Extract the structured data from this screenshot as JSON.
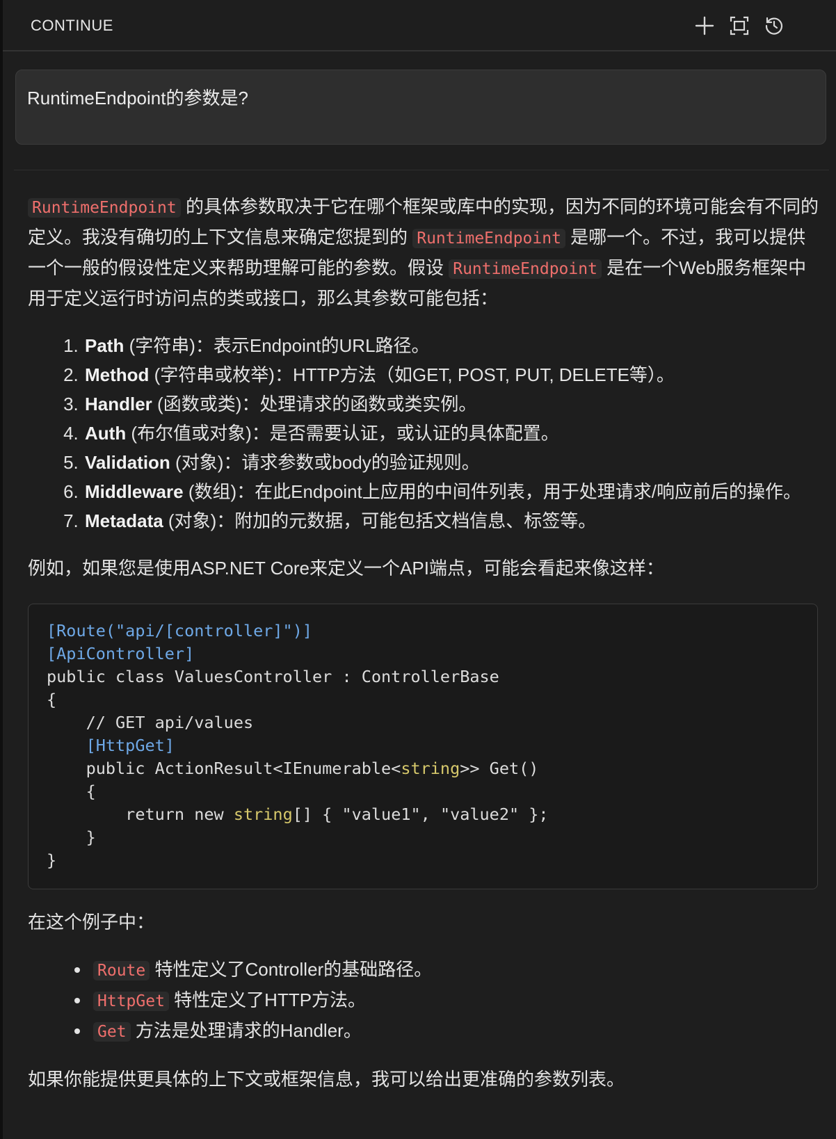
{
  "header": {
    "title": "CONTINUE",
    "icons": [
      "plus-icon",
      "fullscreen-icon",
      "history-icon"
    ]
  },
  "user_message": {
    "text": "RuntimeEndpoint的参数是?"
  },
  "response": {
    "intro": {
      "code1": "RuntimeEndpoint",
      "t1": " 的具体参数取决于它在哪个框架或库中的实现，因为不同的环境可能会有不同的定义。我没有确切的上下文信息来确定您提到的 ",
      "code2": "RuntimeEndpoint",
      "t2": " 是哪一个。不过，我可以提供一个一般的假设性定义来帮助理解可能的参数。假设 ",
      "code3": "RuntimeEndpoint",
      "t3": " 是在一个Web服务框架中用于定义运行时访问点的类或接口，那么其参数可能包括："
    },
    "params": [
      {
        "name": "Path",
        "desc": " (字符串)：表示Endpoint的URL路径。"
      },
      {
        "name": "Method",
        "desc": " (字符串或枚举)：HTTP方法（如GET, POST, PUT, DELETE等）。"
      },
      {
        "name": "Handler",
        "desc": " (函数或类)：处理请求的函数或类实例。"
      },
      {
        "name": "Auth",
        "desc": " (布尔值或对象)：是否需要认证，或认证的具体配置。"
      },
      {
        "name": "Validation",
        "desc": " (对象)：请求参数或body的验证规则。"
      },
      {
        "name": "Middleware",
        "desc": " (数组)：在此Endpoint上应用的中间件列表，用于处理请求/响应前后的操作。"
      },
      {
        "name": "Metadata",
        "desc": " (对象)：附加的元数据，可能包括文档信息、标签等。"
      }
    ],
    "example_intro": "例如，如果您是使用ASP.NET Core来定义一个API端点，可能会看起来像这样：",
    "code": {
      "l1_attr": "[Route(\"api/[controller]\")]",
      "l2_attr": "[ApiController]",
      "l3": "public class ValuesController : ControllerBase",
      "l4": "{",
      "l5": "    // GET api/values",
      "l6_indent": "    ",
      "l6_attr": "[HttpGet]",
      "l7_a": "    public ActionResult<IEnumerable<",
      "l7_type": "string",
      "l7_b": ">> Get()",
      "l8": "    {",
      "l9_a": "        return new ",
      "l9_type": "string",
      "l9_b": "[] { \"value1\", \"value2\" };",
      "l10": "    }",
      "l11": "}"
    },
    "in_example": "在这个例子中：",
    "bullets": [
      {
        "code": "Route",
        "text": " 特性定义了Controller的基础路径。"
      },
      {
        "code": "HttpGet",
        "text": " 特性定义了HTTP方法。"
      },
      {
        "code": "Get",
        "text": " 方法是处理请求的Handler。"
      }
    ],
    "closing": "如果你能提供更具体的上下文或框架信息，我可以给出更准确的参数列表。"
  }
}
